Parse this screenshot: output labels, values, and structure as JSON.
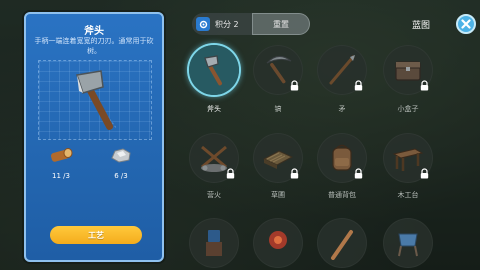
{
  "detail": {
    "title": "斧头",
    "description": "手柄一端连着宽宽的刀刃。通常用于砍树。",
    "materials": [
      {
        "icon": "log-icon",
        "count": "11 /3"
      },
      {
        "icon": "stone-icon",
        "count": "6 /3"
      }
    ],
    "craft_label": "工艺"
  },
  "topbar": {
    "points_label": "积分 2",
    "reset_label": "重置",
    "blueprint_label": "蓝图"
  },
  "items": [
    {
      "label": "斧头",
      "icon": "axe-icon",
      "locked": false,
      "selected": true
    },
    {
      "label": "镐",
      "icon": "pickaxe-icon",
      "locked": true,
      "selected": false
    },
    {
      "label": "矛",
      "icon": "spear-icon",
      "locked": true,
      "selected": false
    },
    {
      "label": "小盒子",
      "icon": "small-box-icon",
      "locked": true,
      "selected": false
    },
    {
      "label": "营火",
      "icon": "campfire-icon",
      "locked": true,
      "selected": false
    },
    {
      "label": "草圃",
      "icon": "grass-bed-icon",
      "locked": true,
      "selected": false
    },
    {
      "label": "普通背包",
      "icon": "backpack-icon",
      "locked": true,
      "selected": false
    },
    {
      "label": "木工台",
      "icon": "workbench-icon",
      "locked": true,
      "selected": false
    },
    {
      "label": "",
      "icon": "furnace-icon",
      "locked": false,
      "selected": false
    },
    {
      "label": "",
      "icon": "fire-pit-icon",
      "locked": false,
      "selected": false
    },
    {
      "label": "",
      "icon": "club-icon",
      "locked": false,
      "selected": false
    },
    {
      "label": "",
      "icon": "chair-icon",
      "locked": false,
      "selected": false
    }
  ]
}
